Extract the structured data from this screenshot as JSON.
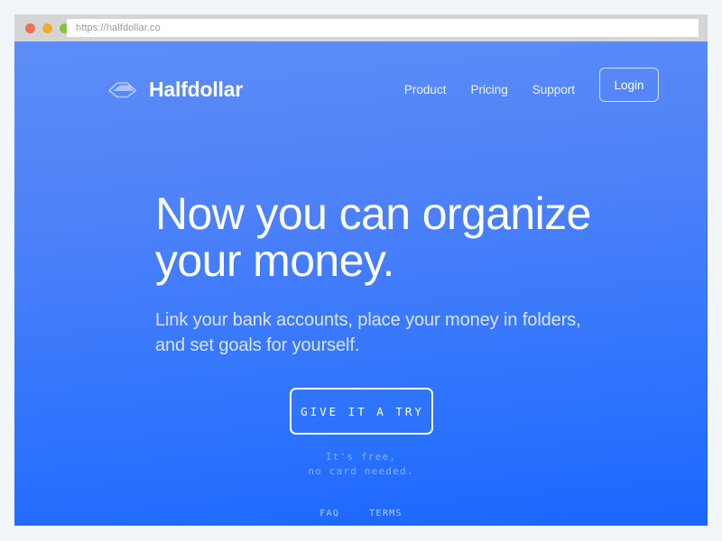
{
  "browser": {
    "url": "https://halfdollar.co",
    "traffic_lights": [
      "close-red",
      "minimize-yellow",
      "maximize-green"
    ],
    "colors": {
      "chrome": "#d5d5d6",
      "red": "#ef6f51",
      "yellow": "#eeae2c",
      "green": "#86c43a",
      "page_background": "#f2f5f9"
    }
  },
  "site": {
    "colors": {
      "gradient_top": "#5d8df7",
      "gradient_bottom": "#1a67ff",
      "text_primary": "#ffffff",
      "text_muted": "#d9e4fd"
    },
    "header": {
      "logo_mark": "halfdollar-diamond-icon",
      "logo_text": "Halfdollar",
      "nav": [
        {
          "label": "Product"
        },
        {
          "label": "Pricing"
        },
        {
          "label": "Support"
        }
      ],
      "login_label": "Login"
    },
    "hero": {
      "headline": "Now you can organize your money.",
      "subhead": "Link your bank accounts, place your money in folders, and set goals for yourself.",
      "cta_label": "GIVE IT A TRY",
      "cta_note_line1": "It's free,",
      "cta_note_line2": "no card needed."
    },
    "footer": {
      "links": [
        {
          "label": "FAQ"
        },
        {
          "label": "TERMS"
        }
      ]
    }
  }
}
